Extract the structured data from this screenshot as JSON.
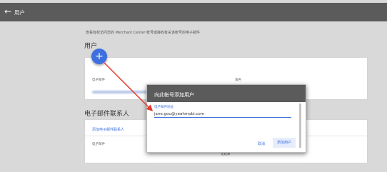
{
  "topbar": {
    "back_icon": "←",
    "title": "用户"
  },
  "intro_text": "查看有权访问您的 Merchant Center 帐号或接收有关该帐号的电子邮件",
  "users_section": {
    "title": "用户",
    "fab_icon": "+",
    "columns": [
      "电子邮件",
      "角色"
    ]
  },
  "contacts_section": {
    "title": "电子邮件联系人",
    "add_link": "添加电子邮件联系人",
    "column": "电子邮件",
    "empty_text": "无结果"
  },
  "dialog": {
    "title": "向此帐号添加用户",
    "field_label": "电子邮件地址",
    "field_value": "jane.gou@yeahmobi.com",
    "cancel_label": "取消",
    "add_label": "添加用户"
  },
  "colors": {
    "accent": "#3d6fde",
    "topbar": "#5b5b5b",
    "arrow": "#e5392c"
  }
}
